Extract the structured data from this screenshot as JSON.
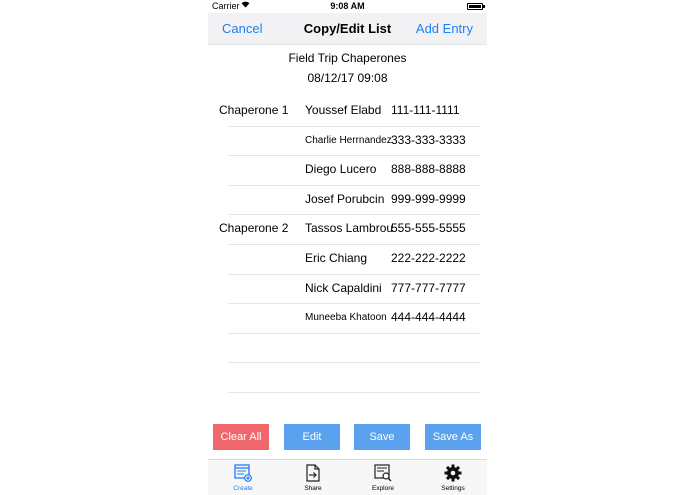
{
  "status_bar": {
    "carrier": "Carrier",
    "time": "9:08 AM"
  },
  "nav": {
    "cancel": "Cancel",
    "title": "Copy/Edit List",
    "add": "Add Entry"
  },
  "list": {
    "name": "Field Trip Chaperones",
    "date": "08/12/17 09:08"
  },
  "rows": [
    {
      "group": "Chaperone 1",
      "name": "Youssef Elabd",
      "phone": "111-111-1111"
    },
    {
      "group": "",
      "name": "Charlie Herrnandez",
      "phone": "333-333-3333"
    },
    {
      "group": "",
      "name": "Diego Lucero",
      "phone": "888-888-8888"
    },
    {
      "group": "",
      "name": "Josef Porubcin",
      "phone": "999-999-9999"
    },
    {
      "group": "Chaperone 2",
      "name": "Tassos Lambrou",
      "phone": "555-555-5555"
    },
    {
      "group": "",
      "name": "Eric Chiang",
      "phone": "222-222-2222"
    },
    {
      "group": "",
      "name": "Nick Capaldini",
      "phone": "777-777-7777"
    },
    {
      "group": "",
      "name": "Muneeba Khatoon",
      "phone": "444-444-4444"
    },
    {
      "group": "",
      "name": "",
      "phone": ""
    },
    {
      "group": "",
      "name": "",
      "phone": ""
    }
  ],
  "buttons": {
    "clear": "Clear All",
    "edit": "Edit",
    "save": "Save",
    "save_as": "Save As"
  },
  "tabs": [
    {
      "label": "Create",
      "icon": "create-icon",
      "active": true
    },
    {
      "label": "Share",
      "icon": "share-icon",
      "active": false
    },
    {
      "label": "Explore",
      "icon": "explore-icon",
      "active": false
    },
    {
      "label": "Settings",
      "icon": "settings-icon",
      "active": false
    }
  ],
  "colors": {
    "accent": "#1e7ff5",
    "clear": "#f0676b",
    "button": "#5aa2ee"
  }
}
